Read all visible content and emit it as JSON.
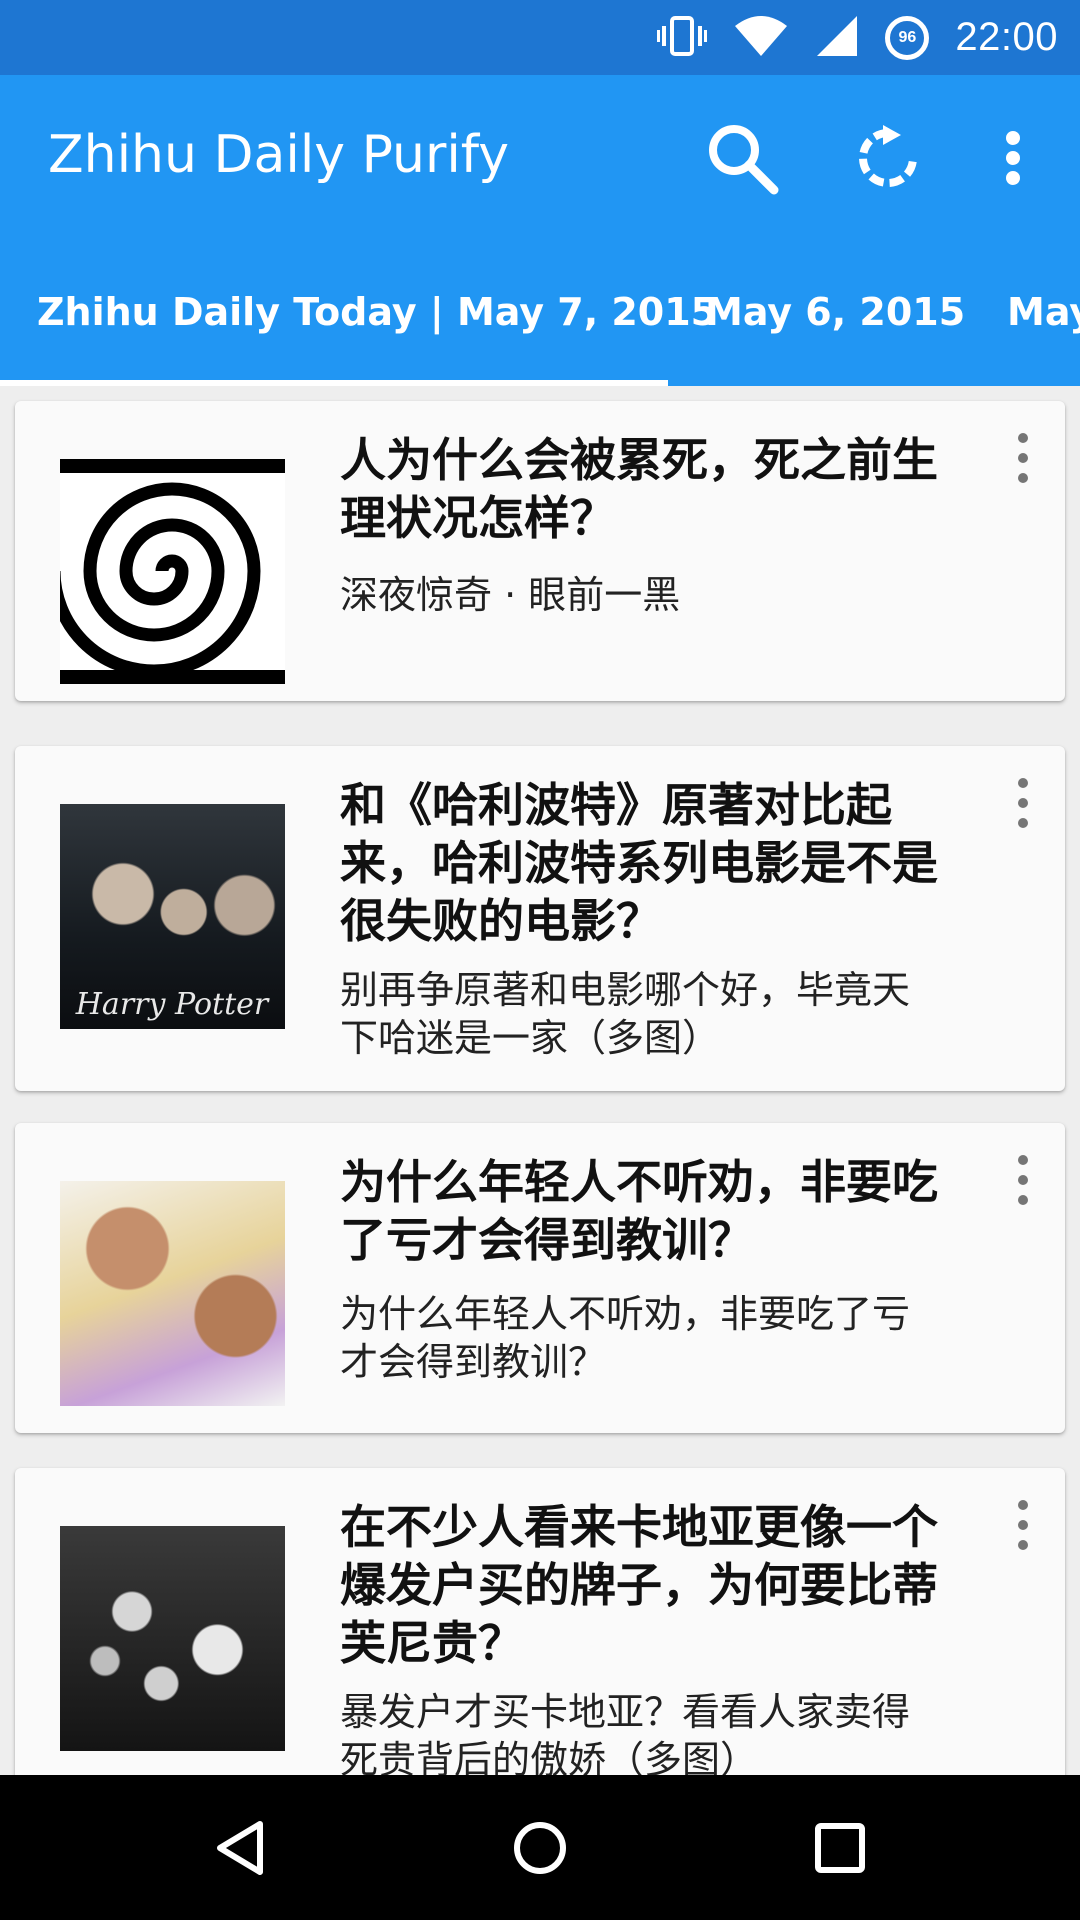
{
  "status_bar": {
    "time": "22:00",
    "battery_level": "96",
    "icons": [
      "vibrate-icon",
      "wifi-icon",
      "signal-icon",
      "battery-icon"
    ]
  },
  "toolbar": {
    "title": "Zhihu Daily Purify",
    "actions": [
      "search-icon",
      "refresh-icon",
      "more-vert-icon"
    ]
  },
  "tabs": [
    {
      "label": "Zhihu Daily Today | May 7, 2015",
      "selected": true
    },
    {
      "label": "May 6, 2015",
      "selected": false
    },
    {
      "label": "May",
      "selected": false
    }
  ],
  "stories": [
    {
      "title": "人为什么会被累死，死之前生理状况怎样？",
      "subtitle": "深夜惊奇 · 眼前一黑",
      "thumbnail": "swirl-image"
    },
    {
      "title": "和《哈利波特》原著对比起来，哈利波特系列电影是不是很失败的电影？",
      "subtitle": "别再争原著和电影哪个好，毕竟天下哈迷是一家（多图）",
      "thumbnail": "harry-potter-poster-image",
      "thumbnail_text": "Harry Potter"
    },
    {
      "title": "为什么年轻人不听劝，非要吃了亏才会得到教训？",
      "subtitle": "为什么年轻人不听劝，非要吃了亏才会得到教训？",
      "thumbnail": "mother-child-photo"
    },
    {
      "title": "在不少人看来卡地亚更像一个爆发户买的牌子，为何要比蒂芙尼贵？",
      "subtitle": "暴发户才买卡地亚？看看人家卖得死贵背后的傲娇（多图）",
      "thumbnail": "diamonds-photo"
    }
  ],
  "colors": {
    "status_bar": "#1e76d2",
    "primary": "#2196f3",
    "card_bg": "#fafafa",
    "page_bg": "#eeeeee",
    "nav_bar": "#000000"
  }
}
